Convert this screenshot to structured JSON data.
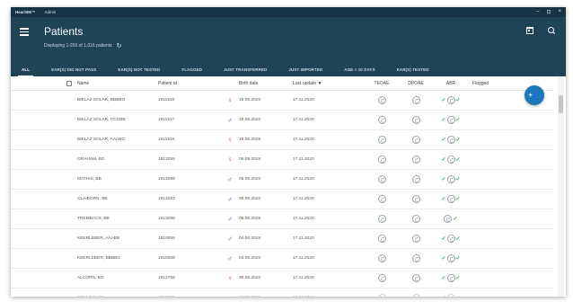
{
  "titlebar": {
    "app_name": "HearSIM™",
    "section": "Admin",
    "minimize": "–",
    "maximize": "⊡",
    "close": "×"
  },
  "header": {
    "title": "Patients",
    "subtitle": "Displaying 1-200 of 1,016 patients",
    "refresh_icon": "↻"
  },
  "tabs": [
    {
      "label": "ALL",
      "active": true
    },
    {
      "label": "EAR(S) DID NOT PASS"
    },
    {
      "label": "EAR(S) NOT TESTED"
    },
    {
      "label": "FLAGGED"
    },
    {
      "label": "JUST TRANSFERRED"
    },
    {
      "label": "JUST IMPORTED"
    },
    {
      "label": "AGE < 10 DAYS"
    },
    {
      "label": "EAR(S) TESTED"
    }
  ],
  "columns": {
    "name": "Name",
    "patient_id": "Patient id",
    "birth_date": "Birth date",
    "last_update": "Last update ▼",
    "teoae": "TEOAE",
    "dpoae": "DPOAE",
    "abr": "ABR",
    "flagged": "Flagged"
  },
  "symbols": {
    "female": "♀",
    "male": "♂",
    "check": "✓"
  },
  "fab": {
    "label": "+👤"
  },
  "rows": [
    {
      "name": "BIELAZ SOLAR, BBBBG",
      "id": "1811516",
      "gender": "female",
      "birth": "19.08.2019",
      "update": "17.11.2020",
      "abr_left": true,
      "abr_right": true
    },
    {
      "name": "BIELAZ SOLAR, CCCBB",
      "id": "1811517",
      "gender": "male",
      "birth": "19.08.2019",
      "update": "17.11.2020",
      "abr_left": true,
      "abr_right": true
    },
    {
      "name": "BIELAZ SOLAR, AAABG",
      "id": "1811515",
      "gender": "female",
      "birth": "19.08.2019",
      "update": "17.11.2020",
      "abr_left": true,
      "abr_right": true
    },
    {
      "name": "GRAHAM, BG",
      "id": "1813255",
      "gender": "female",
      "birth": "05.09.2019",
      "update": "17.11.2020",
      "abr_left": true,
      "abr_right": true
    },
    {
      "name": "MATHIS, BB",
      "id": "1813085",
      "gender": "male",
      "birth": "06.09.2019",
      "update": "17.11.2020",
      "abr_left": true,
      "abr_right": true
    },
    {
      "name": "CLAIBORN, BB",
      "id": "1813283",
      "gender": "male",
      "birth": "05.09.2019",
      "update": "17.11.2020",
      "abr_left": true,
      "abr_right": true
    },
    {
      "name": "TREMBACK, BB",
      "id": "1813286",
      "gender": "male",
      "birth": "05.09.2019",
      "update": "17.11.2020",
      "abr_left": false,
      "abr_right": true
    },
    {
      "name": "KEERLEBER, AAABB",
      "id": "1810055",
      "gender": "male",
      "birth": "04.08.2019",
      "update": "17.11.2020",
      "abr_left": true,
      "abr_right": true
    },
    {
      "name": "KEERLEBER, BBBBG",
      "id": "1810056",
      "gender": "male",
      "birth": "04.08.2019",
      "update": "17.11.2020",
      "abr_left": true,
      "abr_right": true
    },
    {
      "name": "ALCORN, BG",
      "id": "1812756",
      "gender": "female",
      "birth": "30.08.2019",
      "update": "17.11.2020",
      "abr_left": true,
      "abr_right": true
    },
    {
      "name": "COLLINS, BB",
      "id": "1813360",
      "gender": "male",
      "birth": "05.09.2019",
      "update": "17.11.2020",
      "abr_left": true,
      "abr_right": true
    }
  ]
}
